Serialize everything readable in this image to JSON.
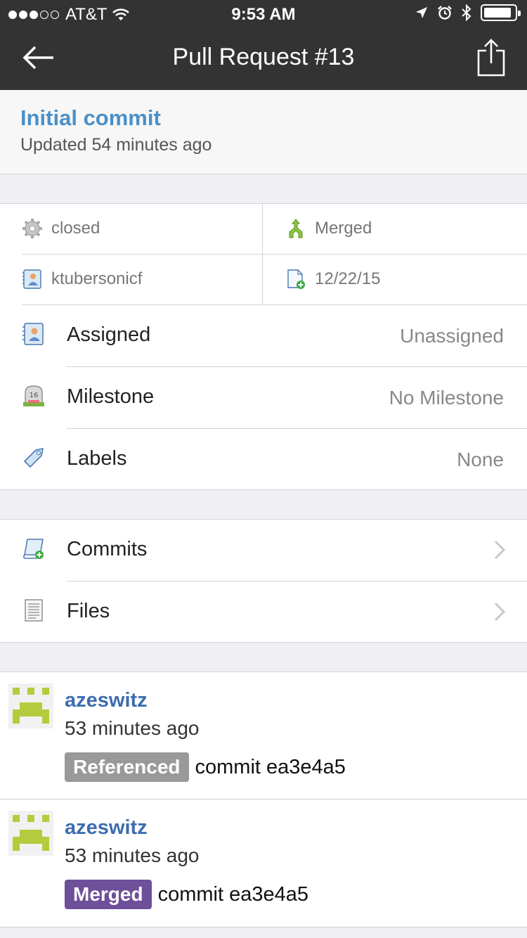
{
  "status_bar": {
    "carrier": "AT&T",
    "time": "9:53 AM"
  },
  "nav": {
    "title": "Pull Request #13"
  },
  "header": {
    "commit_title": "Initial commit",
    "updated": "Updated 54 minutes ago"
  },
  "info": {
    "state": "closed",
    "merge_status": "Merged",
    "author": "ktubersonicf",
    "date": "12/22/15"
  },
  "details": [
    {
      "label": "Assigned",
      "value": "Unassigned",
      "icon": "user-card-icon"
    },
    {
      "label": "Milestone",
      "value": "No Milestone",
      "icon": "milestone-icon"
    },
    {
      "label": "Labels",
      "value": "None",
      "icon": "tag-icon"
    }
  ],
  "links": [
    {
      "label": "Commits",
      "icon": "commit-scroll-icon"
    },
    {
      "label": "Files",
      "icon": "file-document-icon"
    }
  ],
  "events": [
    {
      "user": "azeswitz",
      "time": "53 minutes ago",
      "badge": "Referenced",
      "badge_color": "#999999",
      "text": "commit ea3e4a5"
    },
    {
      "user": "azeswitz",
      "time": "53 minutes ago",
      "badge": "Merged",
      "badge_color": "#6e4f9a",
      "text": "commit ea3e4a5"
    }
  ],
  "colors": {
    "topbar": "#333333",
    "link_blue": "#4a90c8",
    "user_blue": "#3d6db0",
    "avatar_green": "#b3cc3d"
  }
}
